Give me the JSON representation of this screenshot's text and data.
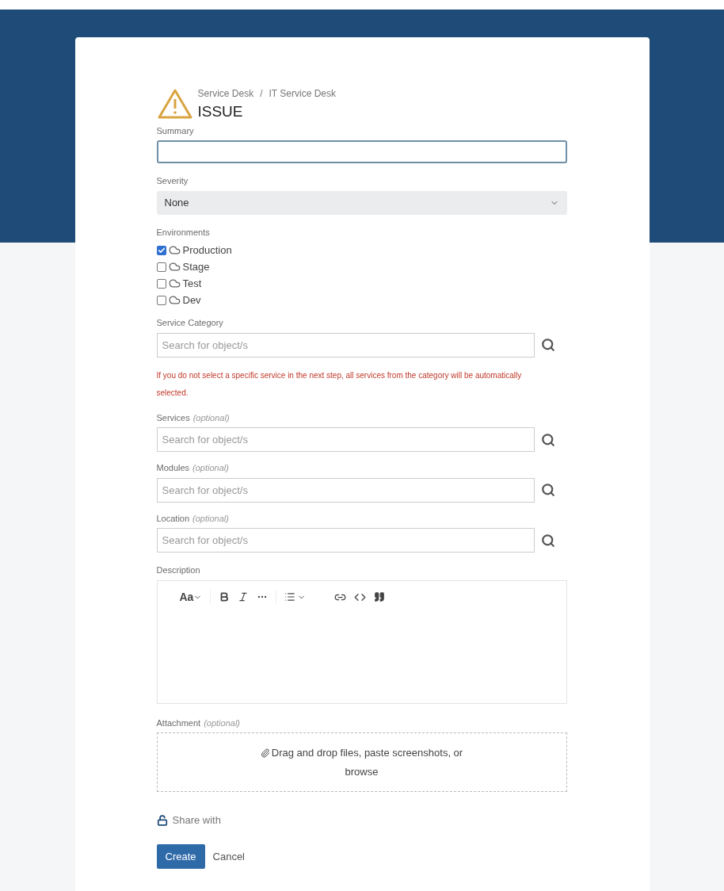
{
  "breadcrumb": [
    "Service Desk",
    "IT Service Desk"
  ],
  "breadcrumb_separator": "/",
  "title": "ISSUE",
  "summary": {
    "label": "Summary"
  },
  "severity": {
    "label": "Severity",
    "value": "None"
  },
  "environments": {
    "label": "Environments",
    "items": [
      {
        "label": "Production",
        "checked": true
      },
      {
        "label": "Stage",
        "checked": false
      },
      {
        "label": "Test",
        "checked": false
      },
      {
        "label": "Dev",
        "checked": false
      }
    ]
  },
  "lookups": [
    {
      "label": "Service Category",
      "placeholder": "Search for object/s",
      "warning": "If you do not select a specific service in the next step, all services from the category will be automatically selected."
    },
    {
      "label": "Services",
      "optional_text": "(optional)",
      "placeholder": "Search for object/s"
    },
    {
      "label": "Modules",
      "optional_text": "(optional)",
      "placeholder": "Search for object/s"
    },
    {
      "label": "Location",
      "optional_text": "(optional)",
      "placeholder": "Search for object/s"
    }
  ],
  "description": {
    "label": "Description",
    "text_style": "Aa"
  },
  "attachment": {
    "label": "Attachment",
    "optional_text": "(optional)",
    "drop_text": "Drag and drop files, paste screenshots, or",
    "browse": "browse"
  },
  "share": "Share with",
  "buttons": {
    "create": "Create",
    "cancel": "Cancel"
  }
}
